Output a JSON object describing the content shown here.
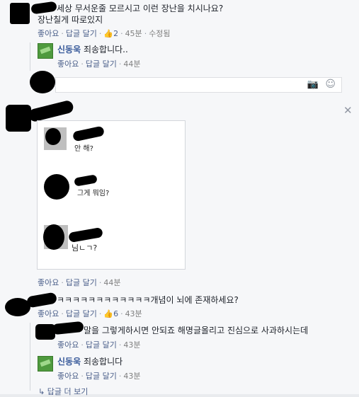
{
  "comments": [
    {
      "text_line1": "세상 무서운줄 모르시고 이런 장난을 치시나요?",
      "text_line2": "장난칠게 따로있지",
      "actions": {
        "like": "좋아요",
        "reply": "답글 달기",
        "likes": "2",
        "time": "45분",
        "edited": "수정됨"
      },
      "reply": {
        "author": "신동욱",
        "text": "죄송합니다..",
        "actions": {
          "like": "좋아요",
          "reply": "답글 달기",
          "time": "44분"
        }
      }
    },
    {
      "image_labels": [
        "안 해?",
        "그게 뭐임?",
        "님ㄴㄱ?"
      ],
      "actions": {
        "like": "좋아요",
        "reply": "답글 달기",
        "time": "44분"
      }
    },
    {
      "text": "ㅋㅋㅋㅋㅋㅋㅋㅋㅋㅋㅋㅋ개념이 뇌에 존재하세요?",
      "actions": {
        "like": "좋아요",
        "reply": "답글 달기",
        "likes": "6",
        "time": "43분"
      },
      "replies": [
        {
          "text": "말을 그렇게하시면 안되죠 해명글올리고 진심으로 사과하시는데",
          "actions": {
            "like": "좋아요",
            "reply": "답글 달기",
            "time": "43분"
          }
        },
        {
          "author": "신동욱",
          "text": "죄송합니다",
          "actions": {
            "like": "좋아요",
            "reply": "답글 달기",
            "time": "43분"
          }
        }
      ],
      "more_replies": "답글 더 보기"
    }
  ],
  "icons": {
    "camera": "camera-icon",
    "emoji": "emoji-icon",
    "close": "close-icon",
    "like": "thumbs-up-icon",
    "reply_arrow": "reply-arrow-icon"
  }
}
